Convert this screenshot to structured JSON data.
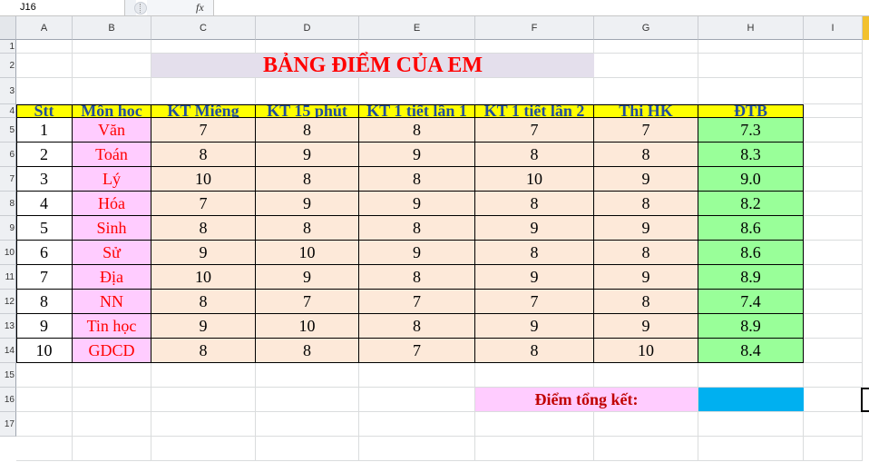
{
  "formula_bar": {
    "name_box": "J16",
    "fx": "fx",
    "formula": ""
  },
  "columns": [
    "A",
    "B",
    "C",
    "D",
    "E",
    "F",
    "G",
    "H",
    "I"
  ],
  "rows": [
    "1",
    "2",
    "3",
    "4",
    "5",
    "6",
    "7",
    "8",
    "9",
    "10",
    "11",
    "12",
    "13",
    "14",
    "15",
    "16",
    "17"
  ],
  "sheet": {
    "title": "BẢNG ĐIỂM CỦA EM",
    "headers": [
      "Stt",
      "Môn học",
      "KT Miệng",
      "KT 15 phút",
      "KT 1 tiết lần 1",
      "KT 1 tiết lần 2",
      "Thi HK",
      "ĐTB"
    ],
    "rows": [
      [
        "1",
        "Văn",
        "7",
        "8",
        "8",
        "7",
        "7",
        "7.3"
      ],
      [
        "2",
        "Toán",
        "8",
        "9",
        "9",
        "8",
        "8",
        "8.3"
      ],
      [
        "3",
        "Lý",
        "10",
        "8",
        "8",
        "10",
        "9",
        "9.0"
      ],
      [
        "4",
        "Hóa",
        "7",
        "9",
        "9",
        "8",
        "8",
        "8.2"
      ],
      [
        "5",
        "Sinh",
        "8",
        "8",
        "8",
        "9",
        "9",
        "8.6"
      ],
      [
        "6",
        "Sử",
        "9",
        "10",
        "9",
        "8",
        "8",
        "8.6"
      ],
      [
        "7",
        "Địa",
        "10",
        "9",
        "8",
        "9",
        "9",
        "8.9"
      ],
      [
        "8",
        "NN",
        "8",
        "7",
        "7",
        "7",
        "8",
        "7.4"
      ],
      [
        "9",
        "Tin học",
        "9",
        "10",
        "8",
        "9",
        "9",
        "8.9"
      ],
      [
        "10",
        "GDCD",
        "8",
        "8",
        "7",
        "8",
        "10",
        "8.4"
      ]
    ],
    "summary_label": "Điểm tổng kết:",
    "summary_value": ""
  },
  "colors": {
    "header_fill": "#ffff00",
    "subject_fill": "#ffccff",
    "score_fill": "#fde9d9",
    "average_fill": "#99ff99",
    "summary_value_fill": "#00b0f0",
    "title_fill": "#e4dfec"
  }
}
